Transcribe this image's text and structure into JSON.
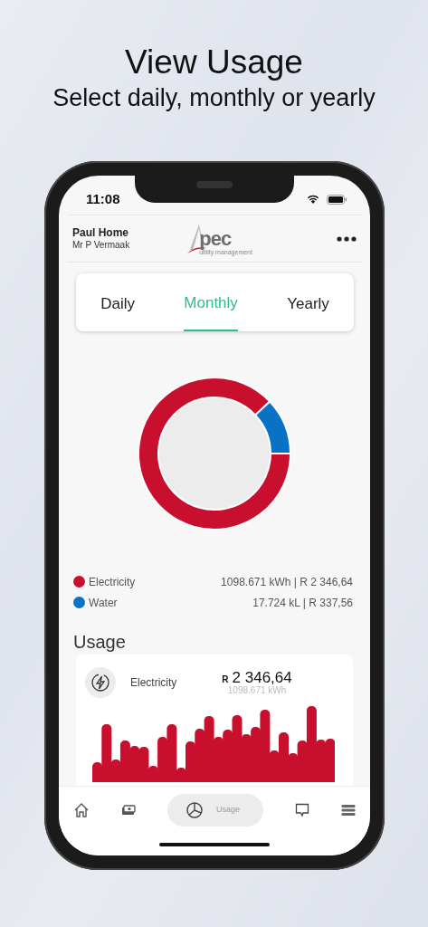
{
  "headline": {
    "title": "View Usage",
    "subtitle": "Select daily, monthly or yearly"
  },
  "status_bar": {
    "time": "11:08"
  },
  "header": {
    "property": "Paul Home",
    "owner": "Mr P Vermaak",
    "logo": {
      "name": "pec",
      "tagline": "utility management"
    }
  },
  "period_tabs": [
    {
      "label": "Daily",
      "selected": false
    },
    {
      "label": "Monthly",
      "selected": true
    },
    {
      "label": "Yearly",
      "selected": false
    }
  ],
  "legend": [
    {
      "name": "Electricity",
      "color": "#c8102e",
      "value": "1098.671 kWh | R 2 346,64"
    },
    {
      "name": "Water",
      "color": "#0a72c4",
      "value": "17.724 kL | R 337,56"
    }
  ],
  "usage": {
    "title": "Usage",
    "card": {
      "utility": "Electricity",
      "currency": "R",
      "amount": "2 346,64",
      "quantity": "1098.671 kWh"
    }
  },
  "nav": [
    {
      "kind": "home",
      "selected": false
    },
    {
      "kind": "money",
      "selected": false
    },
    {
      "kind": "usage",
      "label": "Usage",
      "selected": true
    },
    {
      "kind": "chat",
      "selected": false
    },
    {
      "kind": "menu",
      "selected": false
    }
  ]
}
